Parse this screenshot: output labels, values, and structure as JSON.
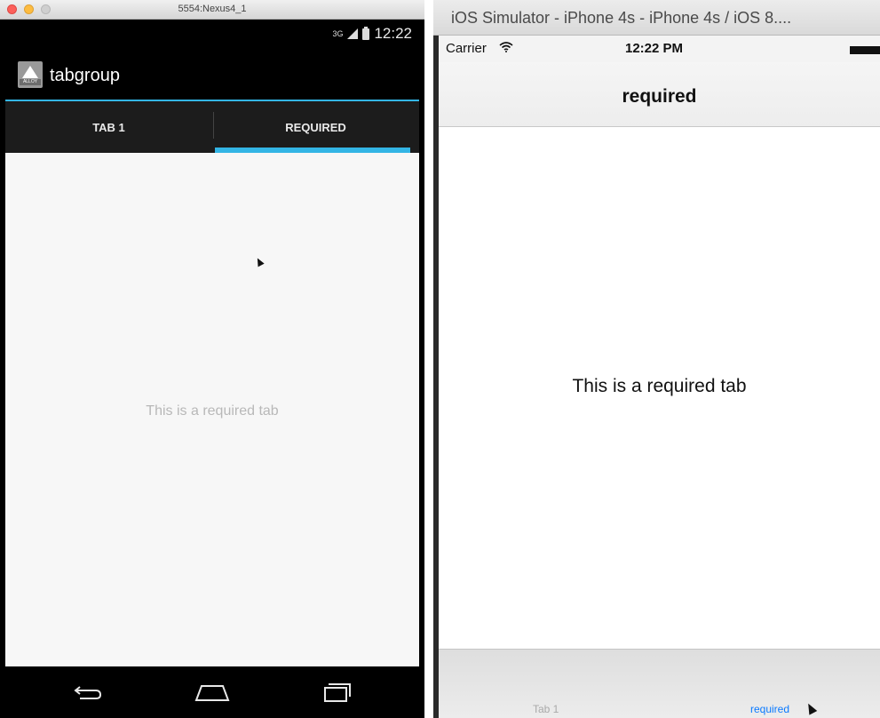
{
  "android": {
    "window_title": "5554:Nexus4_1",
    "status": {
      "network": "3G",
      "time": "12:22"
    },
    "app_title": "tabgroup",
    "logo_text": "ALLOY",
    "tabs": [
      {
        "label": "TAB 1",
        "selected": false
      },
      {
        "label": "REQUIRED",
        "selected": true
      }
    ],
    "content_message": "This is a required tab",
    "accent_color": "#33b5e5",
    "navbar": {
      "buttons": [
        "back-icon",
        "home-icon",
        "recent-apps-icon"
      ]
    }
  },
  "ios": {
    "window_title": "iOS Simulator - iPhone 4s - iPhone 4s / iOS 8....",
    "status": {
      "carrier": "Carrier",
      "wifi_icon": "wifi-icon",
      "time": "12:22 PM"
    },
    "nav_title": "required",
    "content_message": "This is a required tab",
    "tabs": [
      {
        "label": "Tab 1",
        "selected": false
      },
      {
        "label": "required",
        "selected": true
      }
    ],
    "accent_color": "#0a7aff"
  }
}
